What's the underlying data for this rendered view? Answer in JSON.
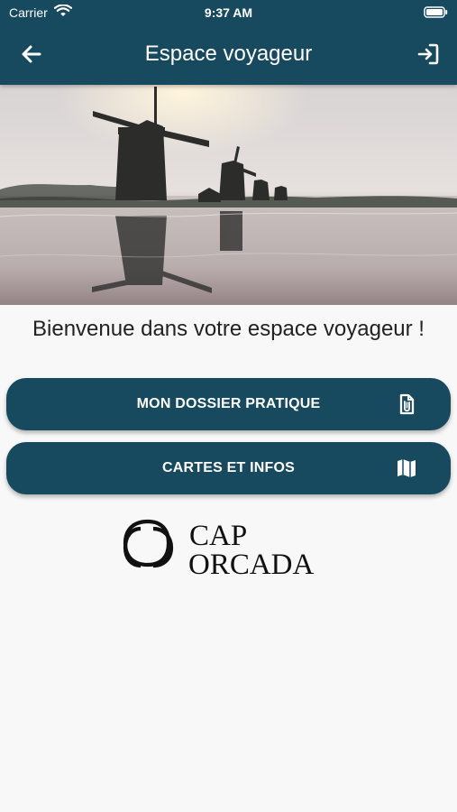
{
  "status_bar": {
    "carrier": "Carrier",
    "time": "9:37 AM",
    "icons": [
      "wifi-icon",
      "battery-icon"
    ]
  },
  "header": {
    "title": "Espace voyageur",
    "back_icon": "arrow-left-icon",
    "logout_icon": "sign-out-icon"
  },
  "hero": {
    "image": "windmills-landscape"
  },
  "welcome": {
    "text": "Bienvenue dans votre espace voyageur !"
  },
  "menu": [
    {
      "label": "MON DOSSIER PRATIQUE",
      "icon": "document-clip-icon"
    },
    {
      "label": "CARTES ET INFOS",
      "icon": "map-icon"
    }
  ],
  "logo": {
    "line1": "CAP",
    "line2": "ORCADA"
  },
  "colors": {
    "primary": "#174a5f",
    "background": "#f8f8f8",
    "text": "#222222",
    "white": "#ffffff"
  }
}
